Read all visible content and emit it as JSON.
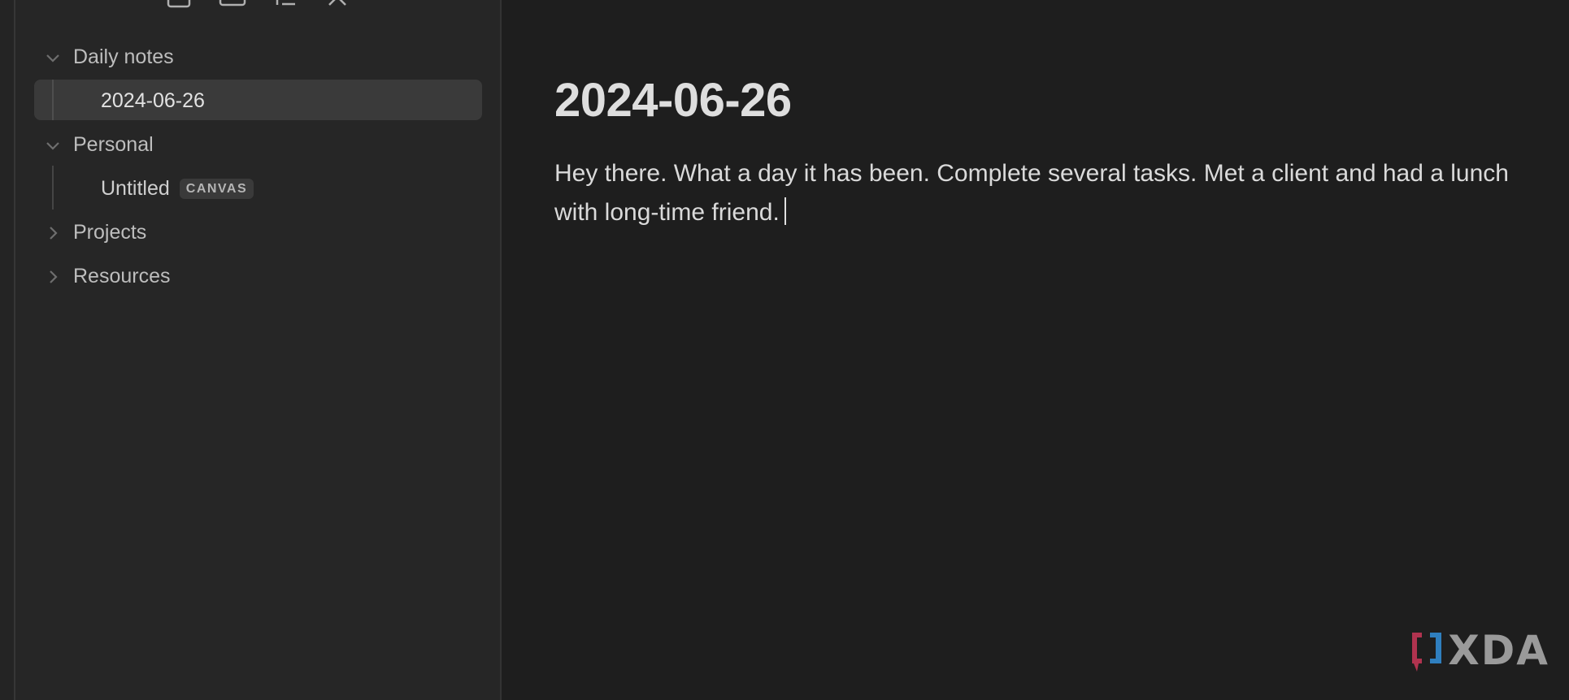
{
  "sidebar": {
    "toolbar_icons": [
      "new-note-icon",
      "new-folder-icon",
      "sort-icon",
      "collapse-all-icon"
    ],
    "tree": [
      {
        "label": "Daily notes",
        "type": "folder",
        "expanded": true
      },
      {
        "label": "2024-06-26",
        "type": "note",
        "active": true
      },
      {
        "label": "Personal",
        "type": "folder",
        "expanded": true
      },
      {
        "label": "Untitled",
        "type": "canvas",
        "badge": "CANVAS"
      },
      {
        "label": "Projects",
        "type": "folder",
        "expanded": false
      },
      {
        "label": "Resources",
        "type": "folder",
        "expanded": false
      }
    ]
  },
  "editor": {
    "title": "2024-06-26",
    "body": "Hey there. What a day it has been. Complete several tasks. Met a client and had a lunch with long-time friend."
  },
  "watermark": {
    "text": "XDA",
    "colors": {
      "left_bracket": "#b0334f",
      "right_bracket": "#2f7fbf",
      "word": "#9a9a9a"
    }
  }
}
